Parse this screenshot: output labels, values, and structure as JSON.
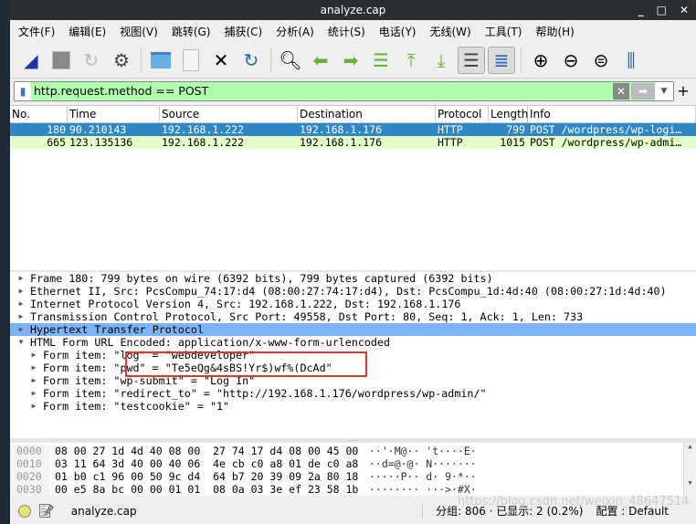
{
  "window": {
    "title": "analyze.cap",
    "controls": [
      "_",
      "□",
      "✕"
    ]
  },
  "menu": [
    "文件(F)",
    "编辑(E)",
    "视图(V)",
    "跳转(G)",
    "捕获(C)",
    "分析(A)",
    "统计(S)",
    "电话(Y)",
    "无线(W)",
    "工具(T)",
    "帮助(H)"
  ],
  "toolbar": [
    "start-capture",
    "stop-capture",
    "restart-capture",
    "capture-options",
    "open-file",
    "save-file",
    "close-file",
    "reload-file",
    "find-packet",
    "go-back",
    "go-forward",
    "go-to-packet",
    "go-first",
    "go-last",
    "auto-scroll",
    "colorize",
    "zoom-in",
    "zoom-out",
    "zoom-normal",
    "resize-columns"
  ],
  "filter": {
    "value": "http.request.method == POST",
    "color": "#afffaf"
  },
  "packet_list": {
    "columns": [
      "No.",
      "Time",
      "Source",
      "Destination",
      "Protocol",
      "Length",
      "Info"
    ],
    "rows": [
      {
        "no": "180",
        "time": "90.210143",
        "src": "192.168.1.222",
        "dst": "192.168.1.176",
        "proto": "HTTP",
        "len": "799",
        "info": "POST /wordpress/wp-logi…",
        "selected": true
      },
      {
        "no": "665",
        "time": "123.135136",
        "src": "192.168.1.222",
        "dst": "192.168.1.176",
        "proto": "HTTP",
        "len": "1015",
        "info": "POST /wordpress/wp-admi…",
        "selected": false
      }
    ]
  },
  "details": [
    {
      "text": "Frame 180: 799 bytes on wire (6392 bits), 799 bytes captured (6392 bits)",
      "expanded": false
    },
    {
      "text": "Ethernet II, Src: PcsCompu_74:17:d4 (08:00:27:74:17:d4), Dst: PcsCompu_1d:4d:40 (08:00:27:1d:4d:40)",
      "expanded": false
    },
    {
      "text": "Internet Protocol Version 4, Src: 192.168.1.222, Dst: 192.168.1.176",
      "expanded": false
    },
    {
      "text": "Transmission Control Protocol, Src Port: 49558, Dst Port: 80, Seq: 1, Ack: 1, Len: 733",
      "expanded": false
    },
    {
      "text": "Hypertext Transfer Protocol",
      "expanded": false,
      "highlighted": true
    },
    {
      "text": "HTML Form URL Encoded: application/x-www-form-urlencoded",
      "expanded": true
    },
    {
      "text": "Form item: \"log\" = \"webdeveloper\"",
      "child": true
    },
    {
      "text": "Form item: \"pwd\" = \"Te5eQg&4sBS!Yr$)wf%(DcAd\"",
      "child": true
    },
    {
      "text": "Form item: \"wp-submit\" = \"Log In\"",
      "child": true
    },
    {
      "text": "Form item: \"redirect_to\" = \"http://192.168.1.176/wordpress/wp-admin/\"",
      "child": true
    },
    {
      "text": "Form item: \"testcookie\" = \"1\"",
      "child": true
    }
  ],
  "hex": [
    {
      "off": "0000",
      "bytes": "08 00 27 1d 4d 40 08 00  27 74 17 d4 08 00 45 00",
      "ascii": "··'·M@·· 't····E·"
    },
    {
      "off": "0010",
      "bytes": "03 11 64 3d 40 00 40 06  4e cb c0 a8 01 de c0 a8",
      "ascii": "··d=@·@· N·······"
    },
    {
      "off": "0020",
      "bytes": "01 b0 c1 96 00 50 9c d4  64 b7 20 39 09 2a 80 18",
      "ascii": "·····P·· d· 9·*··"
    },
    {
      "off": "0030",
      "bytes": "00 e5 8a bc 00 00 01 01  08 0a 03 3e ef 23 58 1b",
      "ascii": "········ ···>·#X·"
    }
  ],
  "status": {
    "file": "analyze.cap",
    "packets": "分组: 806 · 已显示: 2 (0.2%)",
    "profile": "配置 : Default"
  },
  "watermark": "https://blog.csdn.net/weixin_48647514"
}
